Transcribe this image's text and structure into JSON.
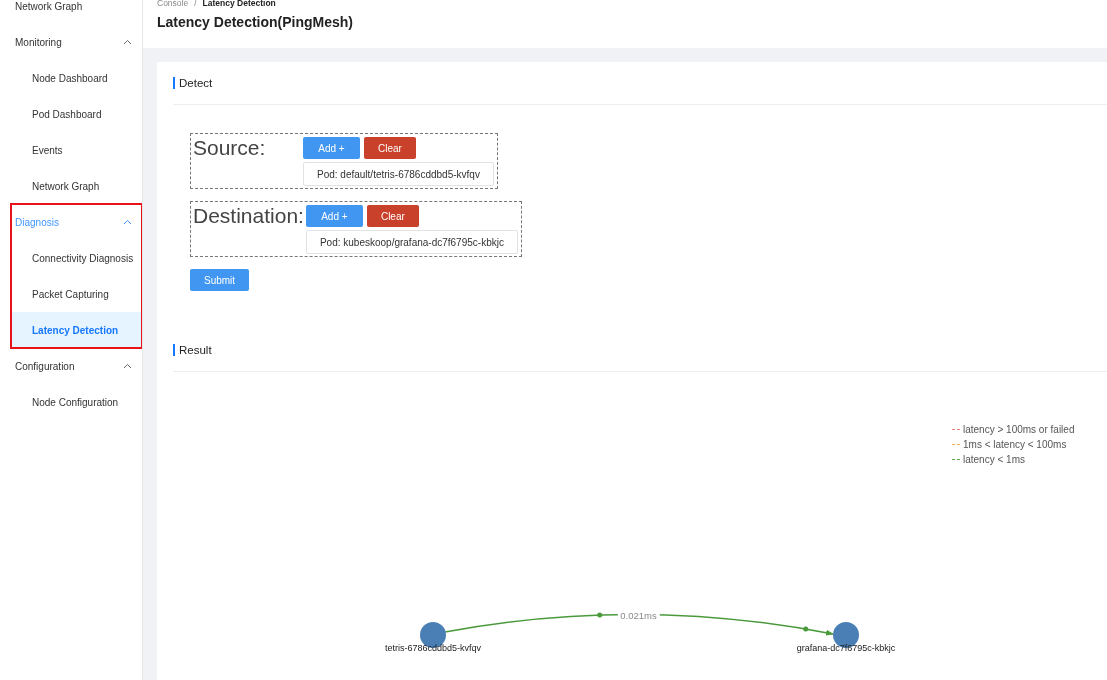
{
  "sidebar": [
    {
      "kind": "item",
      "label": "Network Graph",
      "selected": false
    },
    {
      "kind": "group",
      "label": "Monitoring",
      "expanded": true,
      "active": false,
      "children": [
        {
          "label": "Node Dashboard",
          "selected": false
        },
        {
          "label": "Pod Dashboard",
          "selected": false
        },
        {
          "label": "Events",
          "selected": false
        },
        {
          "label": "Network Graph",
          "selected": false
        }
      ]
    },
    {
      "kind": "group",
      "label": "Diagnosis",
      "expanded": true,
      "active": true,
      "highlighted": true,
      "children": [
        {
          "label": "Connectivity Diagnosis",
          "selected": false
        },
        {
          "label": "Packet Capturing",
          "selected": false
        },
        {
          "label": "Latency Detection",
          "selected": true
        }
      ]
    },
    {
      "kind": "group",
      "label": "Configuration",
      "expanded": true,
      "active": false,
      "children": [
        {
          "label": "Node Configuration",
          "selected": false
        }
      ]
    }
  ],
  "breadcrumb": {
    "items": [
      "Console",
      "Latency Detection"
    ],
    "separator": "/"
  },
  "page_title": "Latency Detection(PingMesh)",
  "detect": {
    "title": "Detect",
    "endpoints": [
      {
        "label": "Source:",
        "add_button": "Add +",
        "clear_button": "Clear",
        "pods": [
          "Pod: default/tetris-6786cddbd5-kvfqv"
        ]
      },
      {
        "label": "Destination:",
        "add_button": "Add +",
        "clear_button": "Clear",
        "pods": [
          "Pod: kubeskoop/grafana-dc7f6795c-kbkjc"
        ]
      }
    ],
    "submit_button": "Submit"
  },
  "result": {
    "title": "Result",
    "legend": [
      {
        "label": "latency > 100ms or failed",
        "color": "#f08080"
      },
      {
        "label": "1ms < latency < 100ms",
        "color": "#f0b050"
      },
      {
        "label": "latency < 1ms",
        "color": "#66aa55"
      }
    ],
    "nodes": [
      {
        "label": "tetris-6786cddbd5-kvfqv"
      },
      {
        "label": "grafana-dc7f6795c-kbkjc"
      }
    ],
    "edges": [
      {
        "label": "0.021ms",
        "color": "#4a9a3c"
      }
    ]
  }
}
